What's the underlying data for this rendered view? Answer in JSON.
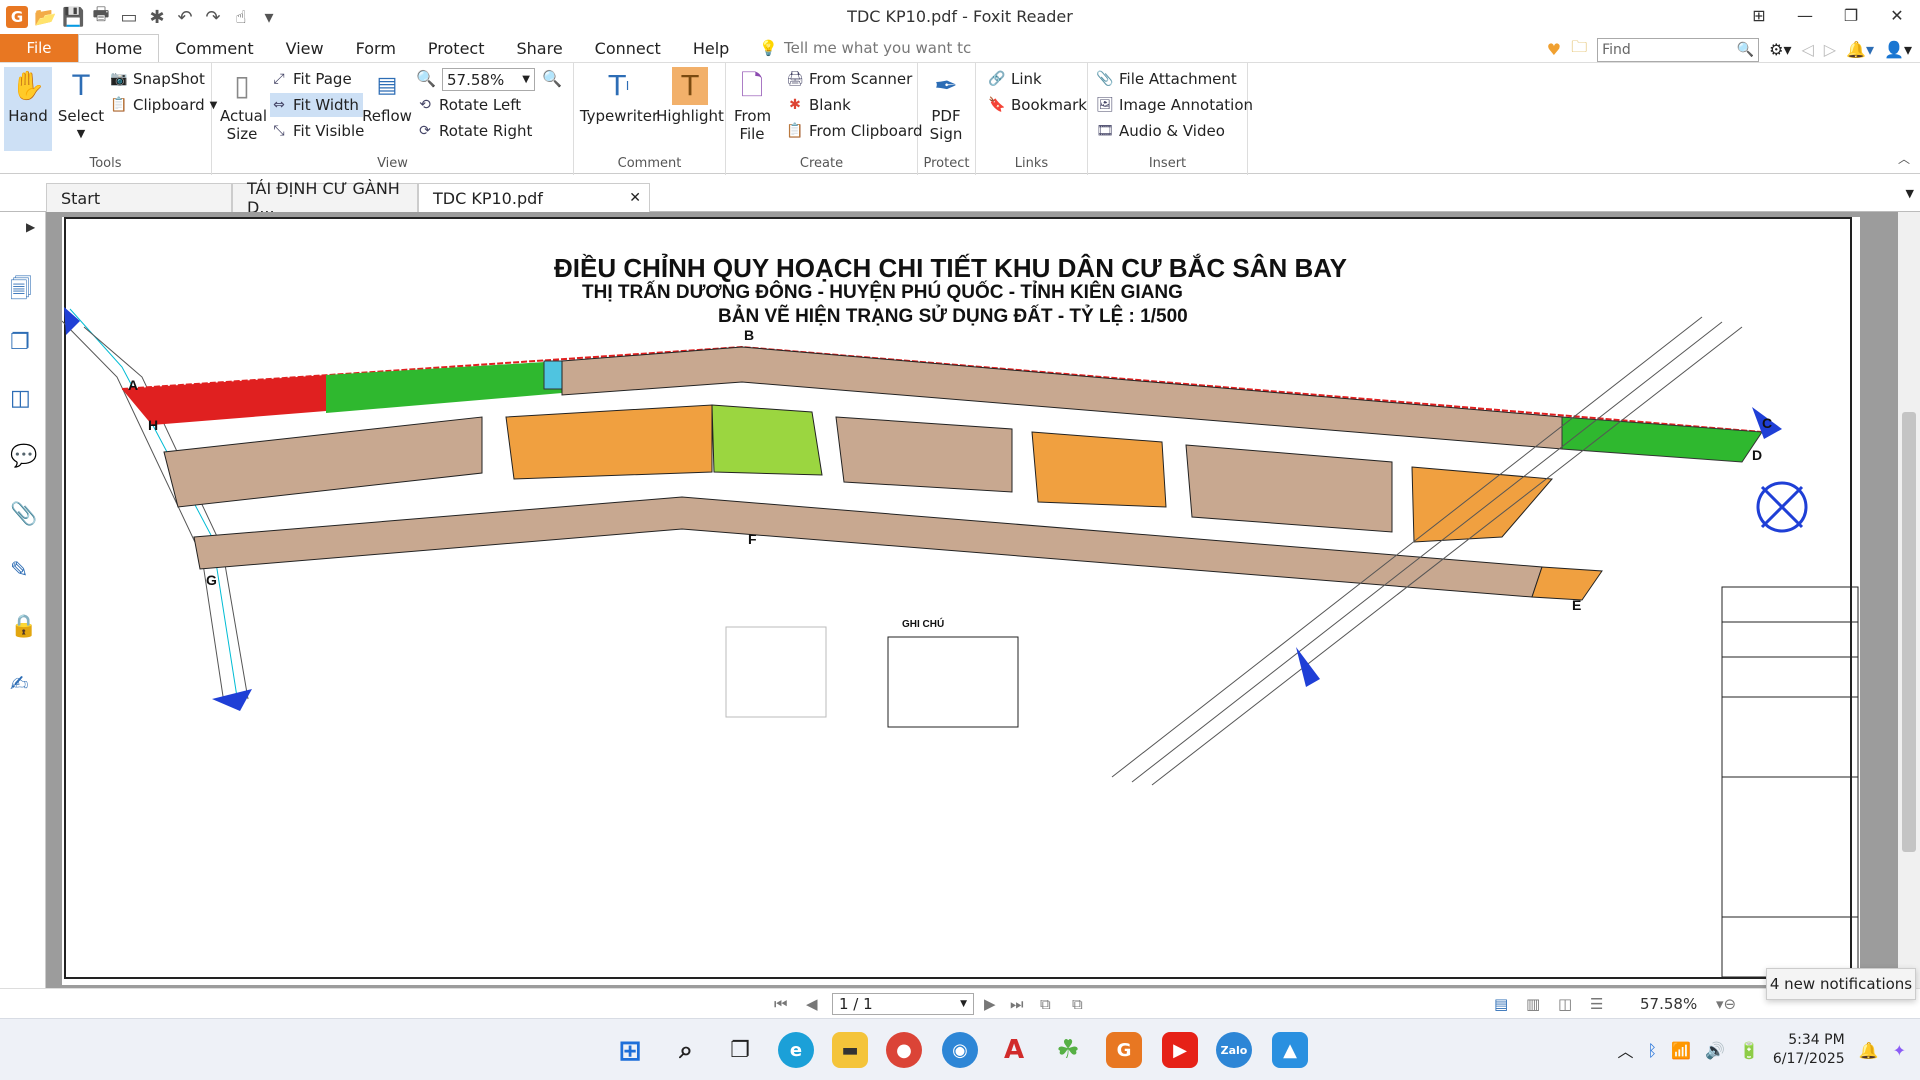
{
  "window": {
    "title": "TDC KP10.pdf - Foxit Reader",
    "app_icon": "G"
  },
  "menu": {
    "file": "File",
    "tabs": [
      "Home",
      "Comment",
      "View",
      "Form",
      "Protect",
      "Share",
      "Connect",
      "Help"
    ],
    "tell_me": "Tell me what you want tc",
    "find_placeholder": "Find"
  },
  "ribbon": {
    "tools": {
      "label": "Tools",
      "hand": "Hand",
      "select": "Select",
      "snapshot": "SnapShot",
      "clipboard": "Clipboard"
    },
    "view": {
      "label": "View",
      "actual_size": "Actual Size",
      "fit_page": "Fit Page",
      "fit_width": "Fit Width",
      "fit_visible": "Fit Visible",
      "reflow": "Reflow",
      "zoom": "57.58%",
      "rotate_left": "Rotate Left",
      "rotate_right": "Rotate Right"
    },
    "comment": {
      "label": "Comment",
      "typewriter": "Typewriter",
      "highlight": "Highlight"
    },
    "create": {
      "label": "Create",
      "from_file": "From File",
      "from_scanner": "From Scanner",
      "blank": "Blank",
      "from_clipboard": "From Clipboard"
    },
    "protect": {
      "label": "Protect",
      "pdf_sign": "PDF Sign"
    },
    "links": {
      "label": "Links",
      "link": "Link",
      "bookmark": "Bookmark"
    },
    "insert": {
      "label": "Insert",
      "file_attachment": "File Attachment",
      "image_annotation": "Image Annotation",
      "audio_video": "Audio & Video"
    }
  },
  "doc_tabs": [
    "Start",
    "TÁI ĐỊNH CƯ GÀNH D...",
    "TDC KP10.pdf"
  ],
  "document": {
    "title": "ĐIỀU CHỈNH QUY HOẠCH CHI TIẾT KHU DÂN CƯ BẮC SÂN BAY",
    "subtitle": "THỊ TRẤN DƯƠNG ĐÔNG - HUYỆN PHÚ QUỐC - TỈNH KIÊN GIANG",
    "subtitle2": "BẢN VẼ HIỆN TRẠNG SỬ DỤNG ĐẤT - TỶ LỆ : 1/500",
    "points": [
      "A",
      "B",
      "C",
      "D",
      "E",
      "F",
      "G",
      "H"
    ],
    "legend_title": "GHI CHÚ"
  },
  "status": {
    "page": "1 / 1",
    "zoom": "57.58%"
  },
  "notification": "4 new notifications",
  "clock": {
    "time": "5:34 PM",
    "date": "6/17/2025"
  },
  "colors": {
    "accent": "#e87722",
    "residential_orange": "#f0a040",
    "residential_brown": "#c8a890",
    "green": "#2fb82f",
    "red": "#e02020"
  }
}
